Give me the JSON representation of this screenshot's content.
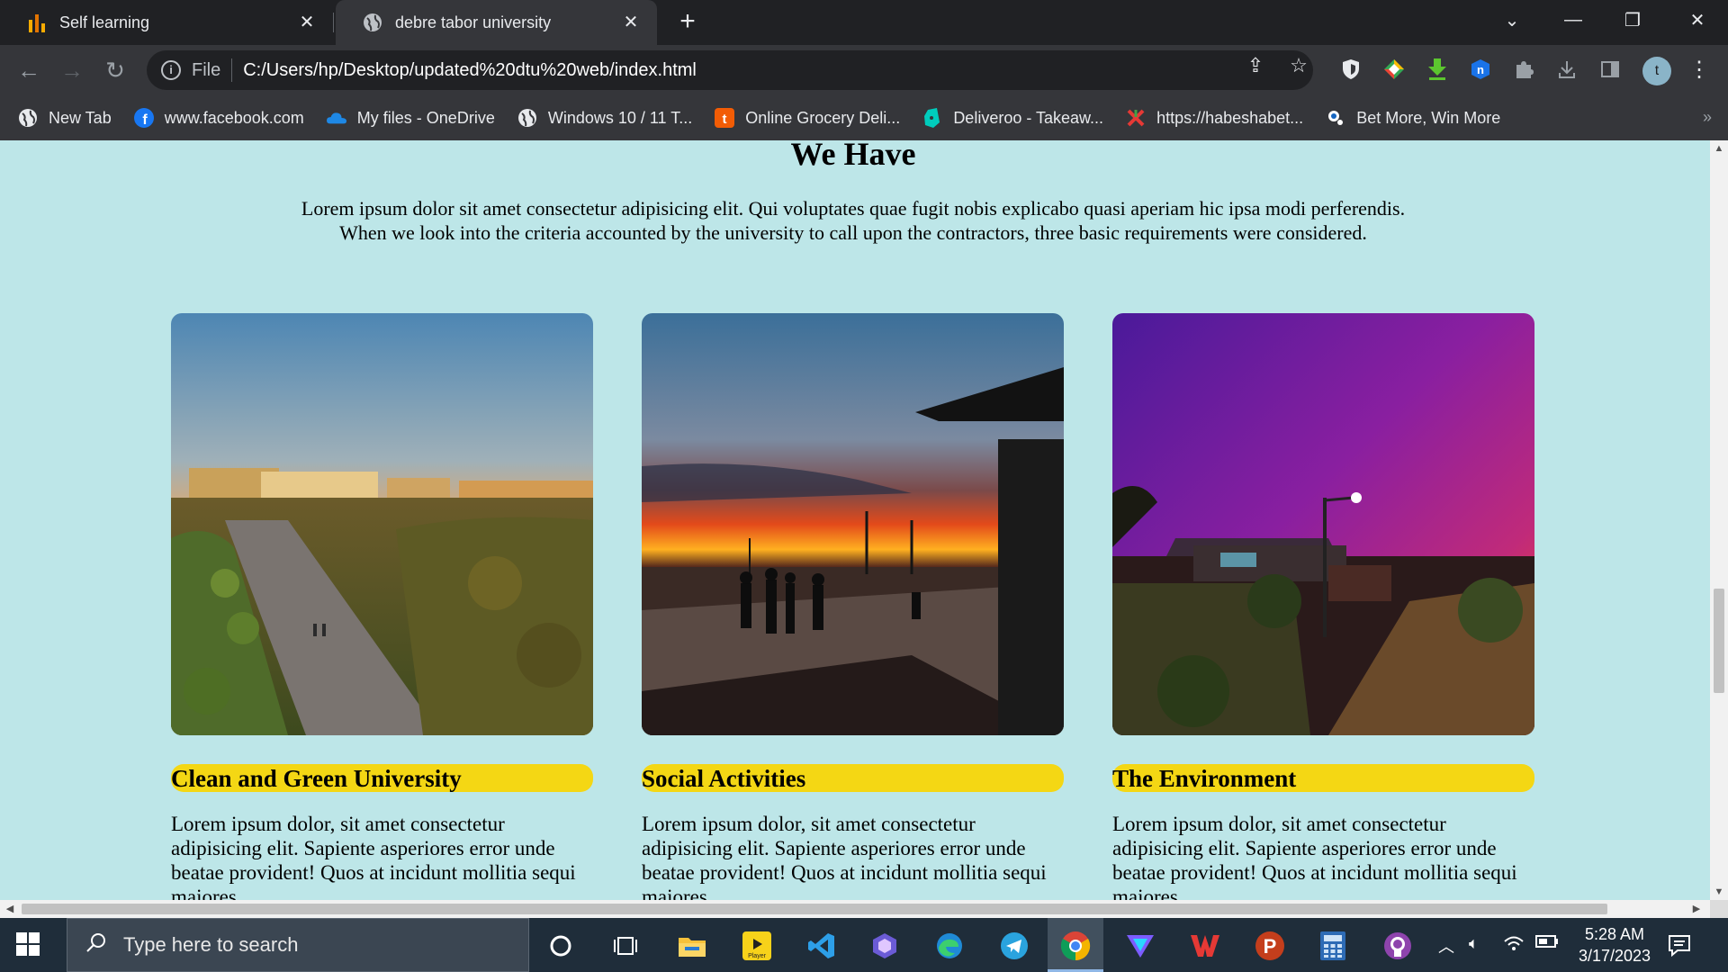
{
  "browser": {
    "tabs": [
      {
        "title": "Self learning",
        "icon": "analytics-icon"
      },
      {
        "title": "debre tabor university",
        "icon": "globe-icon",
        "active": true
      }
    ],
    "new_tab_symbol": "+",
    "address": {
      "scheme": "File",
      "url": "C:/Users/hp/Desktop/updated%20dtu%20web/index.html"
    },
    "profile_initial": "t",
    "bookmarks": [
      {
        "label": "New Tab",
        "icon": "globe-icon"
      },
      {
        "label": "www.facebook.com",
        "icon": "facebook-icon"
      },
      {
        "label": "My files - OneDrive",
        "icon": "onedrive-icon"
      },
      {
        "label": "Windows 10 / 11 T...",
        "icon": "globe-icon"
      },
      {
        "label": "Online Grocery Deli...",
        "icon": "grocery-icon"
      },
      {
        "label": "Deliveroo - Takeaw...",
        "icon": "deliveroo-icon"
      },
      {
        "label": "https://habeshabet...",
        "icon": "habeshabet-icon"
      },
      {
        "label": "Bet More, Win More",
        "icon": "bet-icon"
      }
    ],
    "bookmarks_overflow": "»"
  },
  "page": {
    "heading": "We Have",
    "intro_line1": "Lorem ipsum dolor sit amet consectetur adipisicing elit. Qui voluptates quae fugit nobis explicabo quasi aperiam hic ipsa modi perferendis.",
    "intro_line2": "When we look into the criteria accounted by the university to call upon the contractors, three basic requirements were considered.",
    "cards": [
      {
        "title": "Clean and Green University",
        "text": "Lorem ipsum dolor, sit amet consectetur adipisicing elit. Sapiente asperiores error unde beatae provident! Quos at incidunt mollitia sequi maiores"
      },
      {
        "title": "Social Activities",
        "text": "Lorem ipsum dolor, sit amet consectetur adipisicing elit. Sapiente asperiores error unde beatae provident! Quos at incidunt mollitia sequi maiores"
      },
      {
        "title": "The Environment",
        "text": "Lorem ipsum dolor, sit amet consectetur adipisicing elit. Sapiente asperiores error unde beatae provident! Quos at incidunt mollitia sequi maiores"
      }
    ],
    "highlight_color": "#f4d714",
    "background_color": "#bde6e8"
  },
  "taskbar": {
    "search_placeholder": "Type here to search",
    "time": "5:28 AM",
    "date": "3/17/2023",
    "apps": [
      "cortana-icon",
      "task-view-icon",
      "file-explorer-icon",
      "player-icon",
      "vscode-icon",
      "copilot-icon",
      "edge-icon",
      "telegram-icon",
      "chrome-icon",
      "vpn-icon",
      "wps-icon",
      "powerpoint-icon",
      "calculator-icon",
      "github-icon"
    ],
    "player_label": "Player"
  }
}
